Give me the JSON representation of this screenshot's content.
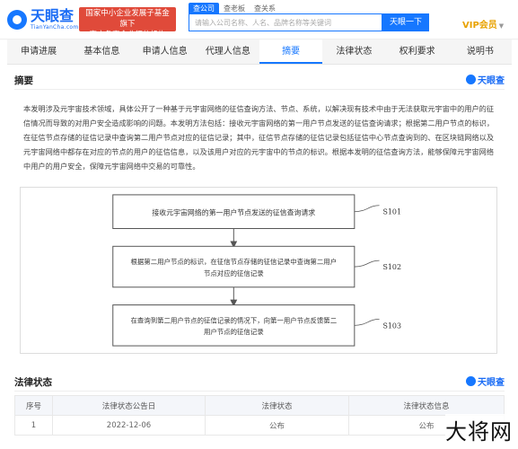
{
  "header": {
    "logo_cn": "天眼查",
    "logo_en": "TianYanCha.com",
    "promo_line1": "国家中小企业发展子基金旗下",
    "promo_line2": "官方备案企业征信机构",
    "search_tabs": [
      "查公司",
      "查老板",
      "查关系"
    ],
    "search_placeholder": "请输入公司名称、人名、品牌名称等关键词",
    "search_button": "天眼一下",
    "vip_label": "VIP会员"
  },
  "nav": {
    "tabs": [
      {
        "label": "申请进展"
      },
      {
        "label": "基本信息"
      },
      {
        "label": "申请人信息"
      },
      {
        "label": "代理人信息"
      },
      {
        "label": "摘要"
      },
      {
        "label": "法律状态"
      },
      {
        "label": "权利要求"
      },
      {
        "label": "说明书"
      }
    ],
    "active_index": 4
  },
  "abstract_section": {
    "title": "摘要",
    "brand": "天眼查",
    "text": "本发明涉及元宇宙技术领域，具体公开了一种基于元宇宙网络的征信查询方法、节点、系统，以解决现有技术中由于无法获取元宇宙中的用户的征信情况而导致的对用户安全造成影响的问题。本发明方法包括：接收元宇宙网络的第一用户节点发送的征信查询请求；根据第二用户节点的标识，在征信节点存储的征信记录中查询第二用户节点对应的征信记录；其中，征信节点存储的征信记录包括征信中心节点查询到的、在区块链网络以及元宇宙网络中都存在对应的节点的用户的征信信息，以及该用户对应的元宇宙中的节点的标识。根据本发明的征信查询方法，能够保障元宇宙网络中用户的用户安全，保障元宇宙网络中交易的可靠性。"
  },
  "figure": {
    "steps": [
      {
        "text_line1": "接收元宇宙网络的第一用户节点发送的征信查询请求",
        "text_line2": "",
        "label": "S101"
      },
      {
        "text_line1": "根据第二用户节点的标识，在征信节点存储的征信记录中查询第二用户",
        "text_line2": "节点对应的征信记录",
        "label": "S102"
      },
      {
        "text_line1": "在查询到第二用户节点的征信记录的情况下，向第一用户节点反馈第二",
        "text_line2": "用户节点的征信记录",
        "label": "S103"
      }
    ]
  },
  "legal_section": {
    "title": "法律状态",
    "brand": "天眼查",
    "columns": [
      "序号",
      "法律状态公告日",
      "法律状态",
      "法律状态信息"
    ],
    "rows": [
      [
        "1",
        "2022-12-06",
        "公布",
        "公布"
      ]
    ]
  },
  "watermark": "大将网"
}
